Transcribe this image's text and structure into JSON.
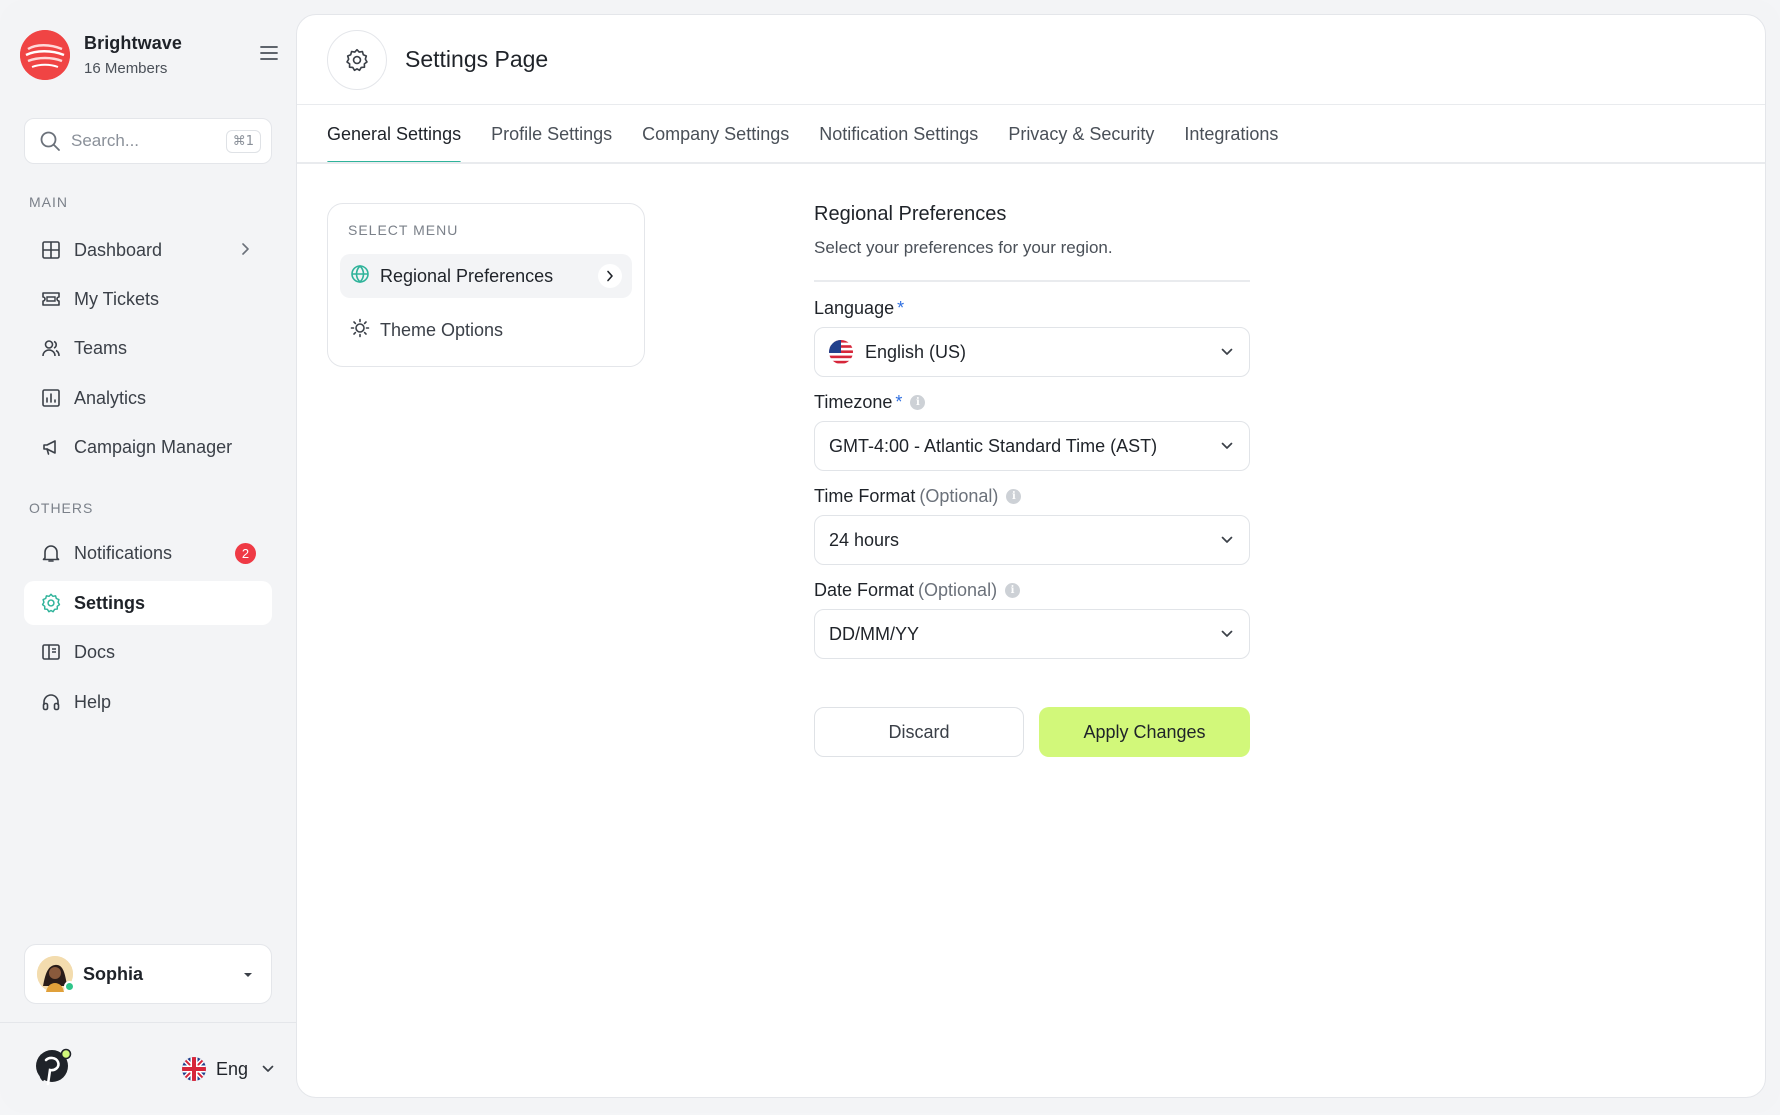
{
  "workspace": {
    "name": "Brightwave",
    "members": "16 Members"
  },
  "search": {
    "placeholder": "Search...",
    "shortcut": "⌘1"
  },
  "sidebar": {
    "main_label": "MAIN",
    "others_label": "OTHERS",
    "main_items": [
      {
        "label": "Dashboard",
        "icon": "dashboard-icon"
      },
      {
        "label": "My Tickets",
        "icon": "ticket-icon"
      },
      {
        "label": "Teams",
        "icon": "users-icon"
      },
      {
        "label": "Analytics",
        "icon": "analytics-icon"
      },
      {
        "label": "Campaign Manager",
        "icon": "megaphone-icon"
      }
    ],
    "other_items": [
      {
        "label": "Notifications",
        "icon": "bell-icon",
        "badge": "2"
      },
      {
        "label": "Settings",
        "icon": "gear-icon",
        "active": true
      },
      {
        "label": "Docs",
        "icon": "docs-icon"
      },
      {
        "label": "Help",
        "icon": "headphones-icon"
      }
    ]
  },
  "user": {
    "name": "Sophia",
    "status": "online"
  },
  "language_switch": {
    "label": "Eng"
  },
  "header": {
    "title": "Settings Page"
  },
  "tabs": [
    {
      "label": "General Settings",
      "active": true
    },
    {
      "label": "Profile Settings"
    },
    {
      "label": "Company Settings"
    },
    {
      "label": "Notification Settings"
    },
    {
      "label": "Privacy & Security"
    },
    {
      "label": "Integrations"
    }
  ],
  "select_menu": {
    "header": "SELECT MENU",
    "items": [
      {
        "label": "Regional Preferences",
        "icon": "globe-icon",
        "active": true
      },
      {
        "label": "Theme Options",
        "icon": "sun-icon"
      }
    ]
  },
  "form": {
    "title": "Regional Preferences",
    "subtitle": "Select your preferences for your region.",
    "fields": {
      "language": {
        "label": "Language",
        "required": "*",
        "value": "English (US)"
      },
      "timezone": {
        "label": "Timezone",
        "required": "*",
        "value": "GMT-4:00 - Atlantic Standard Time (AST)"
      },
      "time_format": {
        "label": "Time Format",
        "optional": "(Optional)",
        "value": "24 hours"
      },
      "date_format": {
        "label": "Date Format",
        "optional": "(Optional)",
        "value": "DD/MM/YY"
      }
    },
    "discard_label": "Discard",
    "apply_label": "Apply Changes"
  },
  "colors": {
    "accent": "#2fb39a",
    "apply": "#d2f87a",
    "brand": "#f04444",
    "badge": "#ef3a45"
  }
}
